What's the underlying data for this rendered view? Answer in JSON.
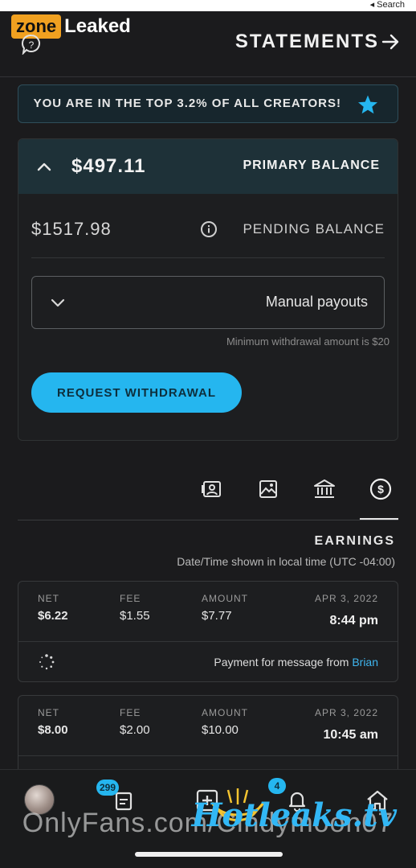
{
  "status_bar": {
    "label": "◂ Search"
  },
  "watermark": {
    "zone": "zone",
    "leaked": "Leaked",
    "hot": "Hotleaks.tv",
    "credit": "OnlyFans.com/Cindymoon07"
  },
  "header": {
    "title": "STATEMENTS",
    "back_icon": "arrow-left-icon",
    "help_icon": "help-icon"
  },
  "banner": {
    "text": "YOU ARE IN THE TOP 3.2% OF ALL CREATORS!",
    "icon": "star-icon",
    "star_color": "#25b6ef"
  },
  "balance": {
    "primary_label": "PRIMARY BALANCE",
    "primary_amount": "$497.11",
    "pending_label": "PENDING BALANCE",
    "pending_amount": "$1517.98",
    "payout_value": "Manual payouts",
    "min_text": "Minimum withdrawal amount is $20",
    "withdraw_label": "REQUEST WITHDRAWAL",
    "accent": "#25b6ef"
  },
  "tabs": [
    {
      "icon": "dollar-circle-icon",
      "active": true
    },
    {
      "icon": "bank-icon",
      "active": false
    },
    {
      "icon": "image-icon",
      "active": false
    },
    {
      "icon": "user-card-icon",
      "active": false
    }
  ],
  "earnings": {
    "title": "EARNINGS",
    "subtitle": "Date/Time shown in local time (UTC -04:00)",
    "columns": {
      "date": "",
      "amount": "AMOUNT",
      "fee": "FEE",
      "net": "NET"
    },
    "rows": [
      {
        "date": "APR 3, 2022",
        "time": "8:44 pm",
        "amount": "$7.77",
        "fee": "$1.55",
        "net": "$6.22",
        "message": "Payment for message from",
        "from": "Brian"
      },
      {
        "date": "APR 3, 2022",
        "time": "10:45 am",
        "amount": "$10.00",
        "fee": "$2.00",
        "net": "$8.00"
      }
    ]
  },
  "bottom_nav": {
    "items": [
      "home-icon",
      "bell-icon",
      "plus-square-icon",
      "messages-icon",
      "avatar"
    ],
    "bell_badge": "4",
    "messages_badge": "299"
  }
}
